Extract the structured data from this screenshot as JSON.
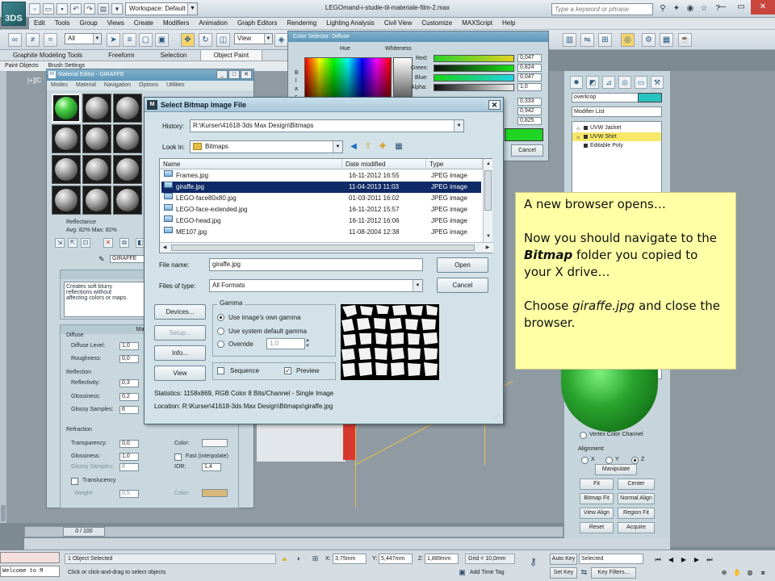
{
  "app": {
    "logo_text": "3DS",
    "workspace_label": "Workspace: Default",
    "window_title": "LEGOmand-i-studie-til-materiale-film-2.max",
    "search_placeholder": "Type a keyword or phrase",
    "menu": [
      "Edit",
      "Tools",
      "Group",
      "Views",
      "Create",
      "Modifiers",
      "Animation",
      "Graph Editors",
      "Rendering",
      "Lighting Analysis",
      "Civil View",
      "Customize",
      "MAXScript",
      "Help"
    ],
    "toolbar": {
      "filter": "All",
      "view": "View"
    },
    "ribbon_tabs": [
      "Graphite Modeling Tools",
      "Freeform",
      "Selection",
      "Object Paint"
    ],
    "ribbon_sub": [
      "Paint Objects",
      "Brush Settings"
    ],
    "viewport_label": "[+][C"
  },
  "material_editor": {
    "title": "Material Editor - GIRAFFE",
    "menu": [
      "Modes",
      "Material",
      "Navigation",
      "Options",
      "Utilities"
    ],
    "reflectance_label": "Reflectance",
    "reflectance_values": "Avg: 82% Max: 82%",
    "material_name": "GIRAFFE",
    "tip_title": "Te",
    "tip_text": [
      "Creates soft blurry",
      "reflections without",
      "affecting colors or maps."
    ],
    "main_title": "Main mate",
    "diffuse": {
      "label": "Diffuse",
      "level_label": "Diffuse Level:",
      "level": "1,0",
      "roughness_label": "Roughness:",
      "roughness": "0,0"
    },
    "reflection": {
      "label": "Reflection",
      "reflectivity_label": "Reflectivity:",
      "reflectivity": "0,3",
      "glossiness_label": "Glossiness:",
      "glossiness": "0,2",
      "samples_label": "Glossy Samples:",
      "samples": "6"
    },
    "refraction": {
      "label": "Refraction",
      "transparency_label": "Transparency:",
      "transparency": "0,0",
      "glossiness_label": "Glossiness:",
      "glossiness": "1,0",
      "samples_label": "Glossy Samples:",
      "samples": "8",
      "color_label": "Color:",
      "fast_label": "Fast (interpolate)",
      "ior_label": "IOR:",
      "ior": "1,4"
    },
    "translucency": {
      "label": "Translucency",
      "weight_label": "Weight:",
      "weight": "0,5",
      "color_label": "Color:"
    }
  },
  "color_selector": {
    "title": "Color Selector: Diffuse",
    "hue_label": "Hue",
    "whiteness_label": "Whiteness",
    "side_letters": [
      "B",
      "l",
      "a",
      "c"
    ],
    "rows": [
      {
        "label": "Red:",
        "value": "0,047"
      },
      {
        "label": "Green:",
        "value": "0,824"
      },
      {
        "label": "Blue:",
        "value": "0,047"
      },
      {
        "label": "Alpha:",
        "value": "1,0"
      }
    ],
    "hsv": [
      "0,333",
      "0,942",
      "0,825"
    ],
    "cancel_label": "Cancel"
  },
  "command_panel": {
    "object_name": "overkrop",
    "modifier_list": "Modifier List",
    "stack": [
      "UVW Jacket",
      "UVW Shirt",
      "Editable Poly"
    ],
    "vertex_color": "Vertex Color Channel",
    "alignment_label": "Alignment:",
    "axes": [
      "X",
      "Y",
      "Z"
    ],
    "buttons": [
      "Manipulate",
      "Fit",
      "Center",
      "Bitmap Fit",
      "Normal Align",
      "View Align",
      "Region Fit",
      "Reset",
      "Acquire"
    ]
  },
  "status": {
    "timeline": "0 / 100",
    "selection": "1 Object Selected",
    "prompt": "Click or click-and-drag to select objects",
    "welcome": "Welcome to M",
    "x_value": "3,75mm",
    "y_value": "5,447mm",
    "z_value": "1,889mm",
    "grid": "Grid = 10,0mm",
    "add_time_tag": "Add Time Tag",
    "auto_key": "Auto Key",
    "set_key": "Set Key",
    "selected": "Selected",
    "key_filters": "Key Filters..."
  },
  "dialog": {
    "title": "Select Bitmap Image File",
    "history_label": "History:",
    "history_value": "R:\\Kurser\\41618-3ds Max Design\\Bitmaps",
    "lookin_label": "Look in:",
    "lookin_value": "Bitmaps",
    "columns": [
      "Name",
      "Date modified",
      "Type"
    ],
    "files": [
      {
        "name": "Frames.jpg",
        "date": "16-11-2012 16:55",
        "type": "JPEG image"
      },
      {
        "name": "giraffe.jpg",
        "date": "11-04-2013 11:03",
        "type": "JPEG image"
      },
      {
        "name": "LEGO-face80x80.jpg",
        "date": "01-03-2011 16:02",
        "type": "JPEG image"
      },
      {
        "name": "LEGO-face-extended.jpg",
        "date": "16-11-2012 15:57",
        "type": "JPEG image"
      },
      {
        "name": "LEGO-head.jpg",
        "date": "16-11-2012 16:06",
        "type": "JPEG image"
      },
      {
        "name": "ME107.jpg",
        "date": "11-08-2004 12:38",
        "type": "JPEG image"
      }
    ],
    "selected_index": 1,
    "filename_label": "File name:",
    "filename_value": "giraffe.jpg",
    "filetype_label": "Files of type:",
    "filetype_value": "All Formats",
    "open_label": "Open",
    "cancel_label": "Cancel",
    "devices_label": "Devices...",
    "setup_label": "Setup...",
    "info_label": "Info...",
    "view_label": "View",
    "gamma_label": "Gamma",
    "gamma_options": [
      "Use image's own gamma",
      "Use system default gamma",
      "Override"
    ],
    "gamma_override_value": "1,0",
    "sequence_label": "Sequence",
    "preview_label": "Preview",
    "statistics": "Statistics:  1158x869, RGB Color 8 Bits/Channel - Single Image",
    "location": "Location:  R:\\Kurser\\41618-3ds Max Design\\Bitmaps\\giraffe.jpg"
  },
  "note": {
    "line1": "A new browser opens…",
    "line2_pre": "Now you should navigate to the ",
    "line2_bold": "Bitmap",
    "line2_post": " folder you copied to your X drive…",
    "line3_pre": "Choose  ",
    "line3_italic": "giraffe.jpg",
    "line3_post": " and close the browser."
  }
}
